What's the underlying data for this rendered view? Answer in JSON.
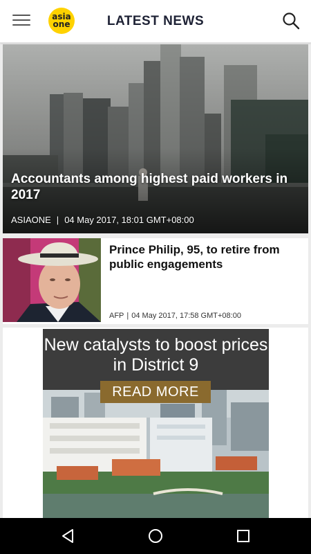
{
  "appbar": {
    "title": "LATEST NEWS",
    "menu_icon": "hamburger-menu-icon",
    "search_icon": "search-icon",
    "logo": {
      "line1": "asia",
      "line2": "one",
      "color": "#ffd200"
    }
  },
  "articles": [
    {
      "headline": "Accountants among highest paid workers in 2017",
      "source": "ASIAONE",
      "separator": "|",
      "timestamp": "04 May 2017, 18:01 GMT+08:00"
    },
    {
      "headline": "Prince Philip, 95, to retire from public engagements",
      "source": "AFP",
      "separator": "|",
      "timestamp": "04 May 2017, 17:58 GMT+08:00"
    }
  ],
  "ad": {
    "text": "New catalysts to boost prices in District 9",
    "button": "READ MORE",
    "button_color": "#8a6a2e"
  },
  "navbar": {
    "back_icon": "back-triangle-icon",
    "home_icon": "home-circle-icon",
    "recents_icon": "recents-square-icon"
  }
}
